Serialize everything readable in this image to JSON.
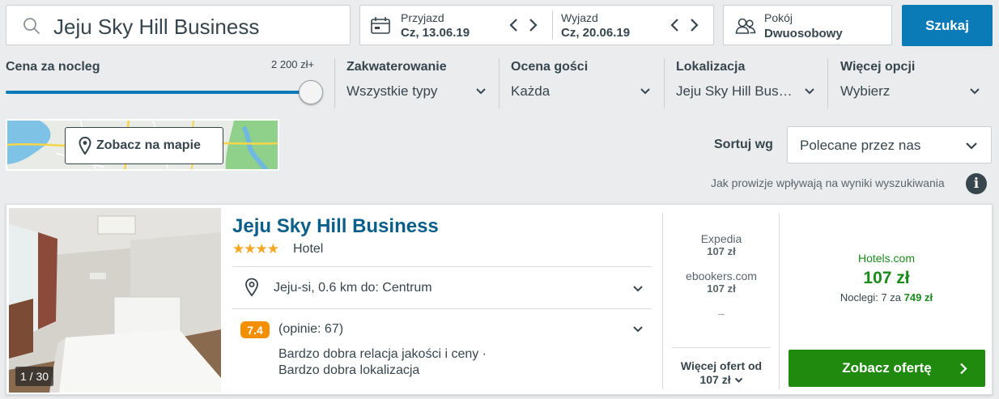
{
  "search": {
    "query": "Jeju Sky Hill Business",
    "button_label": "Szukaj"
  },
  "dates": {
    "checkin_label": "Przyjazd",
    "checkin_value": "Cz, 13.06.19",
    "checkout_label": "Wyjazd",
    "checkout_value": "Cz, 20.06.19"
  },
  "rooms": {
    "label": "Pokój",
    "value": "Dwuosobowy"
  },
  "filters": {
    "price": {
      "label": "Cena za nocleg",
      "max_label": "2 200 zł+",
      "level": 1.0
    },
    "accommodation": {
      "label": "Zakwaterowanie",
      "value": "Wszystkie typy"
    },
    "rating": {
      "label": "Ocena gości",
      "value": "Każda"
    },
    "location": {
      "label": "Lokalizacja",
      "value": "Jeju Sky Hill Bus…"
    },
    "more": {
      "label": "Więcej opcji",
      "value": "Wybierz"
    }
  },
  "map": {
    "button_label": "Zobacz na mapie"
  },
  "sort": {
    "label": "Sortuj wg",
    "value": "Polecane przez nas",
    "note": "Jak prowizje wpływają na wyniki wyszukiwania",
    "info_glyph": "i"
  },
  "hotel": {
    "name": "Jeju Sky Hill Business",
    "stars": 4,
    "type": "Hotel",
    "photo_count": "1 / 30",
    "location": "Jeju-si, 0.6 km do: Centrum",
    "rating": "7.4",
    "reviews": "(opinie: 67)",
    "rating_desc_1": "Bardzo dobra relacja jakości i ceny ·",
    "rating_desc_2": "Bardzo dobra lokalizacja",
    "partners": [
      {
        "name": "Expedia",
        "price": "107 zł"
      },
      {
        "name": "ebookers.com",
        "price": "107 zł"
      }
    ],
    "partner_placeholder": "–",
    "more_offers_line1": "Więcej ofert od",
    "more_offers_line2": "107 zł",
    "best": {
      "provider": "Hotels.com",
      "price": "107 zł",
      "nights_text": "Noclegi: 7 za",
      "nights_total": "749 zł",
      "button_label": "Zobacz ofertę"
    }
  },
  "colors": {
    "accent": "#0a7bb6",
    "deal": "#1f8a0d",
    "rating": "#f48f00",
    "hotel_name": "#0a5f8a"
  }
}
